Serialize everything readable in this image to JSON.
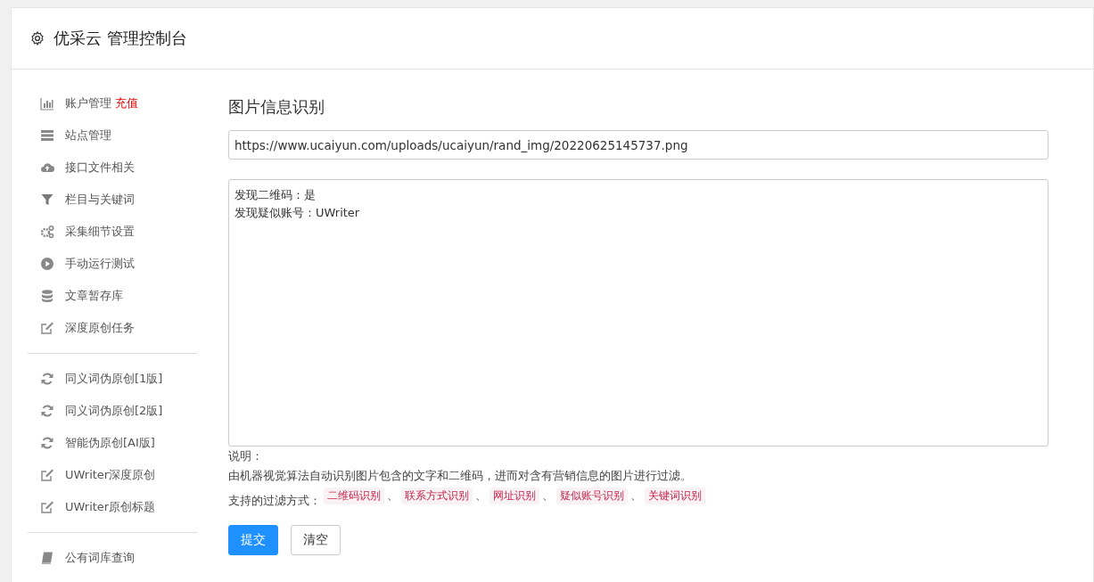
{
  "header": {
    "title": "优采云 管理控制台"
  },
  "sidebar": {
    "groups": [
      {
        "items": [
          {
            "label": "账户管理",
            "badge": "充值"
          },
          {
            "label": "站点管理"
          },
          {
            "label": "接口文件相关"
          },
          {
            "label": "栏目与关键词"
          },
          {
            "label": "采集细节设置"
          },
          {
            "label": "手动运行测试"
          },
          {
            "label": "文章暂存库"
          },
          {
            "label": "深度原创任务"
          }
        ]
      },
      {
        "items": [
          {
            "label": "同义词伪原创[1版]"
          },
          {
            "label": "同义词伪原创[2版]"
          },
          {
            "label": "智能伪原创[AI版]"
          },
          {
            "label": "UWriter深度原创"
          },
          {
            "label": "UWriter原创标题"
          }
        ]
      },
      {
        "items": [
          {
            "label": "公有词库查询"
          }
        ]
      }
    ]
  },
  "main": {
    "heading": "图片信息识别",
    "url_field": {
      "value": "https://www.ucaiyun.com/uploads/ucaiyun/rand_img/20220625145737.png"
    },
    "result_lines": [
      "发现二维码：是",
      "发现疑似账号：UWriter"
    ],
    "notes": {
      "label": "说明：",
      "description": "由机器视觉算法自动识别图片包含的文字和二维码，进而对含有营销信息的图片进行过滤。",
      "methods_label": "支持的过滤方式：",
      "separator": "、",
      "methods": [
        "二维码识别",
        "联系方式识别",
        "网址识别",
        "疑似账号识别",
        "关键词识别"
      ]
    },
    "buttons": [
      {
        "label": "提交",
        "kind": "primary"
      },
      {
        "label": "清空",
        "kind": "default"
      }
    ]
  }
}
